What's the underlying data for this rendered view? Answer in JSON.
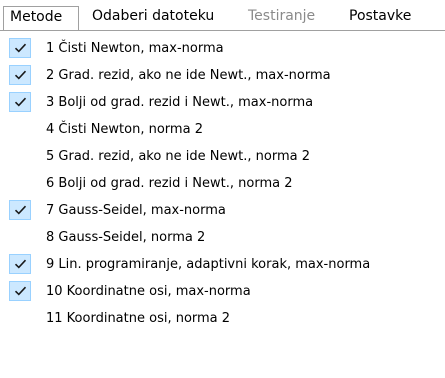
{
  "menu": {
    "tabs": [
      {
        "label": "Metode"
      },
      {
        "label": "Odaberi datoteku"
      },
      {
        "label": "Testiranje"
      },
      {
        "label": "Postavke"
      }
    ]
  },
  "dropdown": {
    "items": [
      {
        "label": "1 Čisti Newton, max-norma",
        "checked": true
      },
      {
        "label": "2 Grad. rezid, ako ne ide Newt., max-norma",
        "checked": true
      },
      {
        "label": "3 Bolji od grad. rezid i Newt., max-norma",
        "checked": true
      },
      {
        "label": "4 Čisti Newton, norma 2",
        "checked": false
      },
      {
        "label": "5 Grad. rezid, ako ne ide Newt., norma 2",
        "checked": false
      },
      {
        "label": "6 Bolji od grad. rezid i Newt., norma 2",
        "checked": false
      },
      {
        "label": "7 Gauss-Seidel, max-norma",
        "checked": true
      },
      {
        "label": "8 Gauss-Seidel, norma 2",
        "checked": false
      },
      {
        "label": "9 Lin. programiranje, adaptivni korak, max-norma",
        "checked": true
      },
      {
        "label": "10 Koordinatne osi, max-norma",
        "checked": true
      },
      {
        "label": "11 Koordinatne osi, norma 2",
        "checked": false
      }
    ]
  },
  "colors": {
    "check_bg": "#cce8ff",
    "check_border": "#99d1ff",
    "disabled_text": "#8a8a8a"
  }
}
